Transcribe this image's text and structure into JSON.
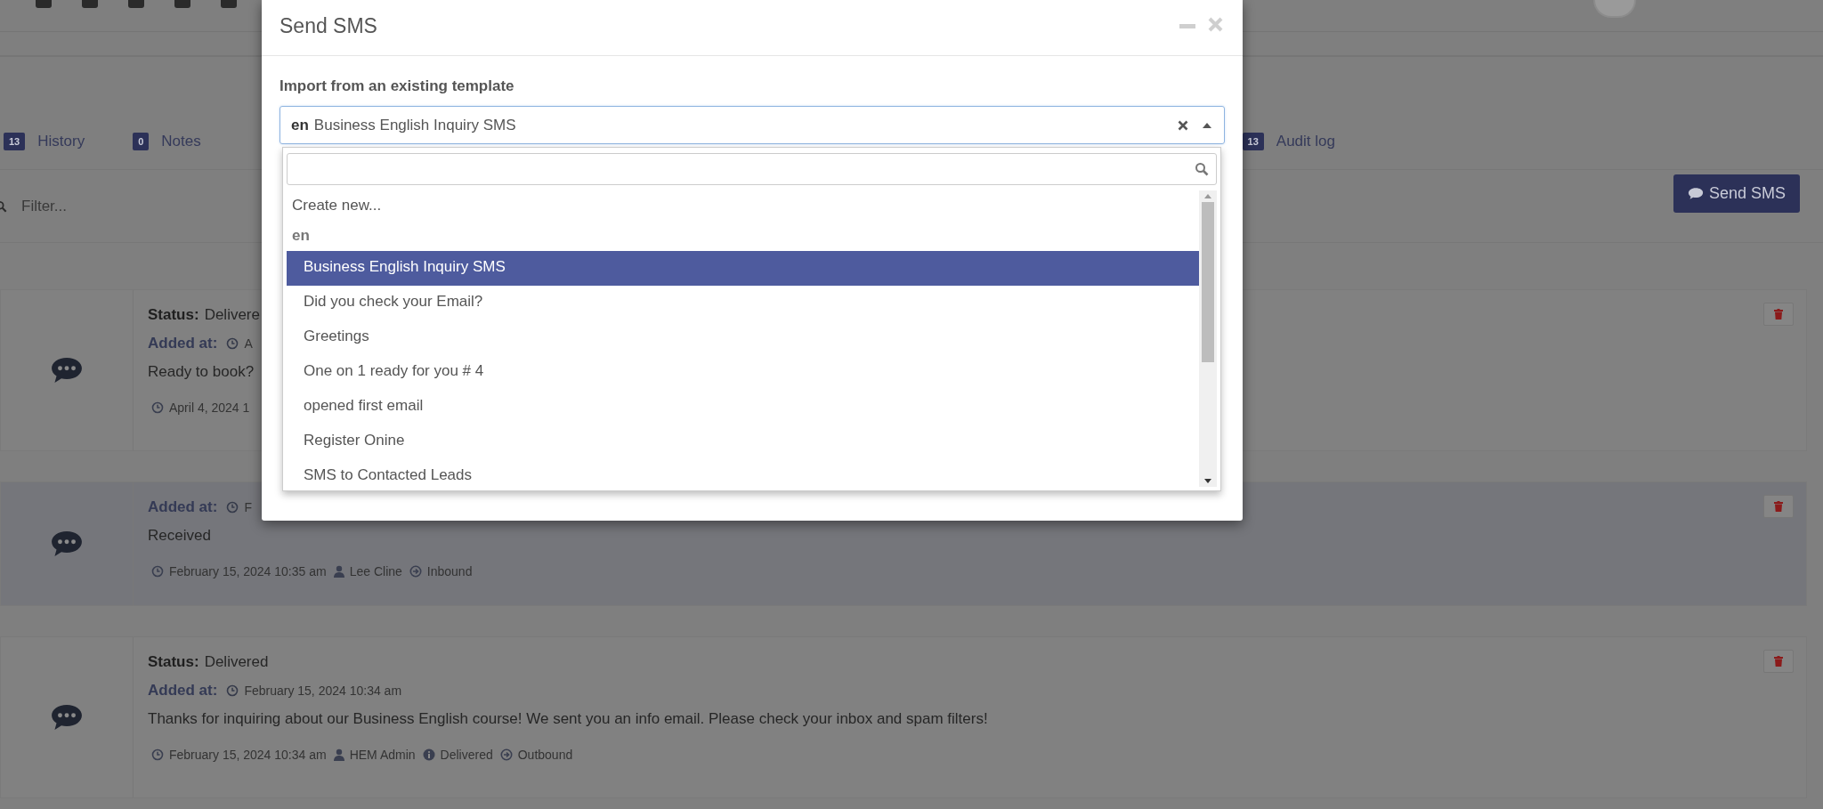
{
  "tabs": [
    {
      "count": "13",
      "label": "History"
    },
    {
      "count": "0",
      "label": "Notes"
    },
    {
      "count": "13",
      "label": "Audit log"
    }
  ],
  "filter": {
    "placeholder": "Filter..."
  },
  "send_sms_button": "Send SMS",
  "timeline": [
    {
      "highlighted": false,
      "status_label": "Status:",
      "status": "Delivere",
      "added_label": "Added at:",
      "added_at": "A",
      "message": "Ready to book?",
      "meta": [
        {
          "kind": "date",
          "text": "April 4, 2024 1"
        }
      ]
    },
    {
      "highlighted": true,
      "added_label": "Added at:",
      "added_at": "F",
      "message": "Received",
      "meta": [
        {
          "kind": "date",
          "text": "February 15, 2024 10:35 am"
        },
        {
          "kind": "user",
          "text": "Lee Cline"
        },
        {
          "kind": "direction",
          "text": "Inbound"
        }
      ]
    },
    {
      "highlighted": false,
      "status_label": "Status:",
      "status": "Delivered",
      "added_label": "Added at:",
      "added_at": "February 15, 2024 10:34 am",
      "message": "Thanks for inquiring about our Business English course! We sent you an info email. Please check your inbox and spam filters!",
      "meta": [
        {
          "kind": "date",
          "text": "February 15, 2024 10:34 am"
        },
        {
          "kind": "user",
          "text": "HEM Admin"
        },
        {
          "kind": "info",
          "text": "Delivered"
        },
        {
          "kind": "direction",
          "text": "Outbound"
        }
      ]
    }
  ],
  "modal": {
    "title": "Send SMS",
    "template_label": "Import from an existing template",
    "select": {
      "language": "en",
      "value": "Business English Inquiry SMS",
      "expanded": true
    },
    "options": [
      {
        "kind": "action",
        "text": "Create new...",
        "selected": false
      },
      {
        "kind": "group",
        "text": "en"
      },
      {
        "kind": "option",
        "text": "Business English Inquiry SMS",
        "selected": true
      },
      {
        "kind": "option",
        "text": "Did you check your Email?",
        "selected": false
      },
      {
        "kind": "option",
        "text": "Greetings",
        "selected": false
      },
      {
        "kind": "option",
        "text": "One on 1 ready for you # 4",
        "selected": false
      },
      {
        "kind": "option",
        "text": "opened first email",
        "selected": false
      },
      {
        "kind": "option",
        "text": "Register Onine",
        "selected": false
      },
      {
        "kind": "option",
        "text": "SMS to Contacted Leads",
        "selected": false
      }
    ]
  }
}
